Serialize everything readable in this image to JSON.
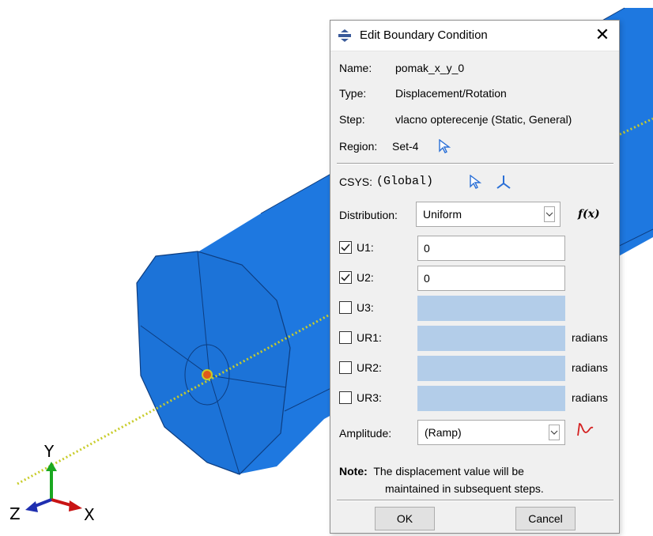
{
  "viewport": {
    "axis_labels": {
      "x": "X",
      "y": "Y",
      "z": "Z"
    },
    "colors": {
      "cylinder": "#1e78e0",
      "cylinder_dark": "#145bb4",
      "path": "#c8cc2a",
      "axis_x": "#c81414",
      "axis_y": "#1aa820",
      "axis_z": "#1f2fb0"
    }
  },
  "dialog": {
    "title": "Edit Boundary Condition",
    "close_glyph": "✕",
    "name_label": "Name:",
    "name_value": "pomak_x_y_0",
    "type_label": "Type:",
    "type_value": "Displacement/Rotation",
    "step_label": "Step:",
    "step_value": "vlacno opterecenje (Static, General)",
    "region_label": "Region:",
    "region_value": "Set-4",
    "csys_label": "CSYS:",
    "csys_value": "(Global)",
    "distribution_label": "Distribution:",
    "distribution_value": "Uniform",
    "fx_label": "f(x)",
    "fields": [
      {
        "label": "U1:",
        "checked": true,
        "value": "0",
        "enabled": true,
        "unit": ""
      },
      {
        "label": "U2:",
        "checked": true,
        "value": "0",
        "enabled": true,
        "unit": ""
      },
      {
        "label": "U3:",
        "checked": false,
        "value": "",
        "enabled": false,
        "unit": ""
      },
      {
        "label": "UR1:",
        "checked": false,
        "value": "",
        "enabled": false,
        "unit": "radians"
      },
      {
        "label": "UR2:",
        "checked": false,
        "value": "",
        "enabled": false,
        "unit": "radians"
      },
      {
        "label": "UR3:",
        "checked": false,
        "value": "",
        "enabled": false,
        "unit": "radians"
      }
    ],
    "amplitude_label": "Amplitude:",
    "amplitude_value": "(Ramp)",
    "note_label": "Note:",
    "note_line1": "The displacement value will be",
    "note_line2": "maintained in subsequent steps.",
    "ok_label": "OK",
    "cancel_label": "Cancel"
  }
}
